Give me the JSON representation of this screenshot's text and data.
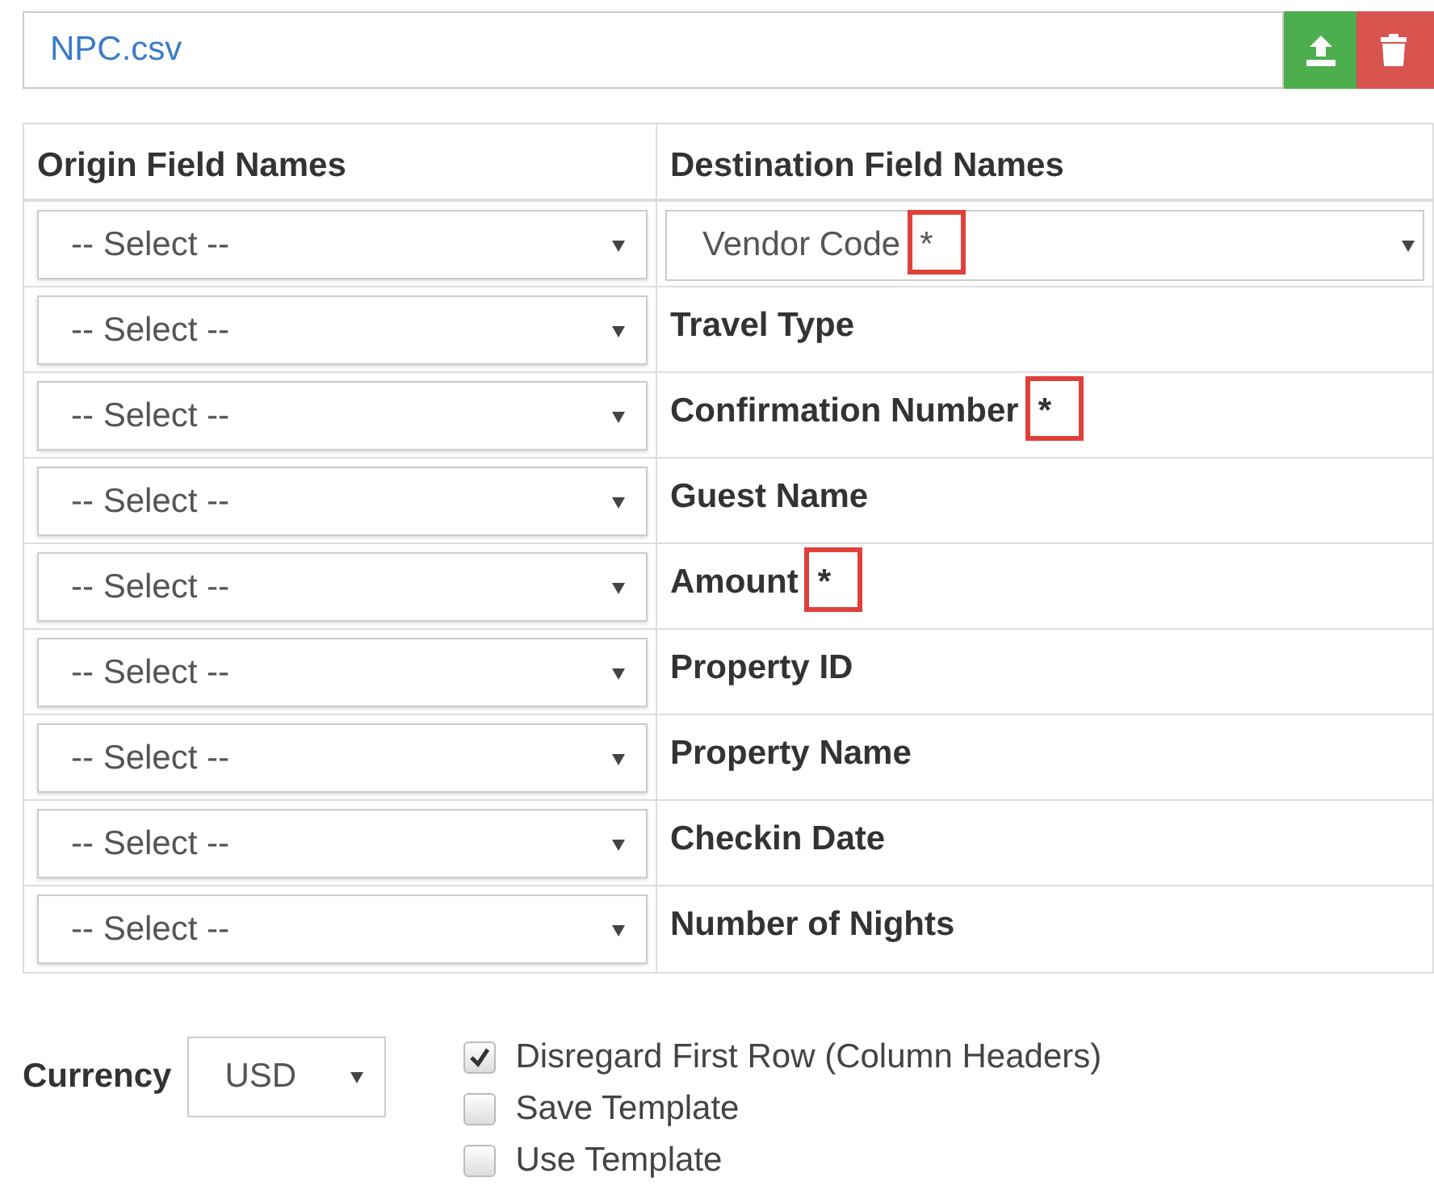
{
  "file": {
    "name": "NPC.csv"
  },
  "table": {
    "columns": [
      "Origin Field Names",
      "Destination Field Names"
    ],
    "rows": [
      {
        "origin": "-- Select --",
        "destination": {
          "kind": "select",
          "label": "Vendor Code",
          "required": "*",
          "highlighted": true
        }
      },
      {
        "origin": "-- Select --",
        "destination": {
          "kind": "text",
          "label": "Travel Type"
        }
      },
      {
        "origin": "-- Select --",
        "destination": {
          "kind": "text",
          "label": "Confirmation Number",
          "required": "*",
          "highlighted": true
        }
      },
      {
        "origin": "-- Select --",
        "destination": {
          "kind": "text",
          "label": "Guest Name"
        }
      },
      {
        "origin": "-- Select --",
        "destination": {
          "kind": "text",
          "label": "Amount",
          "required": "*",
          "highlighted": true
        }
      },
      {
        "origin": "-- Select --",
        "destination": {
          "kind": "text",
          "label": "Property ID"
        }
      },
      {
        "origin": "-- Select --",
        "destination": {
          "kind": "text",
          "label": "Property Name"
        }
      },
      {
        "origin": "-- Select --",
        "destination": {
          "kind": "text",
          "label": "Checkin Date"
        }
      },
      {
        "origin": "-- Select --",
        "destination": {
          "kind": "text",
          "label": "Number of Nights"
        }
      }
    ]
  },
  "currency": {
    "label": "Currency",
    "value": "USD"
  },
  "options": [
    {
      "label": "Disregard First Row (Column Headers)",
      "checked": true
    },
    {
      "label": "Save Template",
      "checked": false
    },
    {
      "label": "Use Template",
      "checked": false
    }
  ]
}
